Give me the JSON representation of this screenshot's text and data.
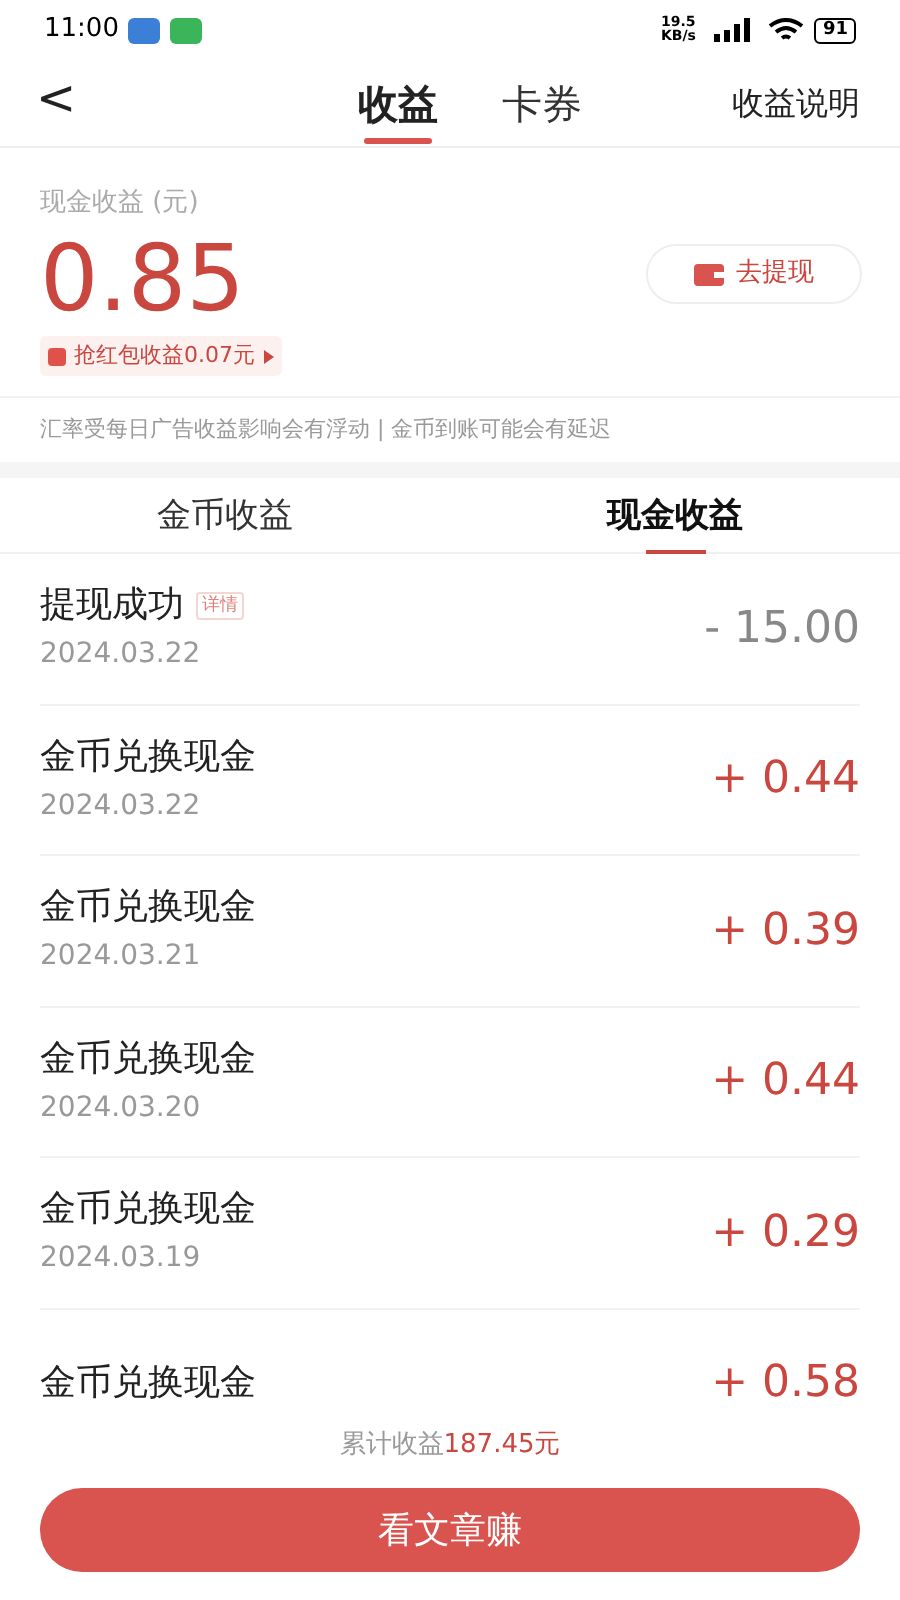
{
  "status_bar": {
    "time": "11:00",
    "net_speed": "19.5 KB/s",
    "battery": "91"
  },
  "header": {
    "back": "<",
    "tabs": [
      {
        "label": "收益",
        "selected": true
      },
      {
        "label": "卡券",
        "selected": false
      }
    ],
    "action": "收益说明"
  },
  "summary": {
    "label": "现金收益 (元)",
    "amount": "0.85",
    "withdraw_button": "去提现",
    "red_packet": "抢红包收益0.07元"
  },
  "notice": "汇率受每日广告收益影响会有浮动 | 金币到账可能会有延迟",
  "sub_tabs": [
    {
      "label": "金币收益",
      "selected": false
    },
    {
      "label": "现金收益",
      "selected": true
    }
  ],
  "records": [
    {
      "title": "提现成功",
      "badge": "详情",
      "date": "2024.03.22",
      "amount": "- 15.00",
      "kind": "debit"
    },
    {
      "title": "金币兑换现金",
      "date": "2024.03.22",
      "amount": "+ 0.44",
      "kind": "credit"
    },
    {
      "title": "金币兑换现金",
      "date": "2024.03.21",
      "amount": "+ 0.39",
      "kind": "credit"
    },
    {
      "title": "金币兑换现金",
      "date": "2024.03.20",
      "amount": "+ 0.44",
      "kind": "credit"
    },
    {
      "title": "金币兑换现金",
      "date": "2024.03.19",
      "amount": "+ 0.29",
      "kind": "credit"
    },
    {
      "title": "金币兑换现金",
      "amount": "+ 0.58",
      "kind": "credit"
    }
  ],
  "footer": {
    "total_label": "累计收益",
    "total_value": "187.45元",
    "button": "看文章赚"
  }
}
